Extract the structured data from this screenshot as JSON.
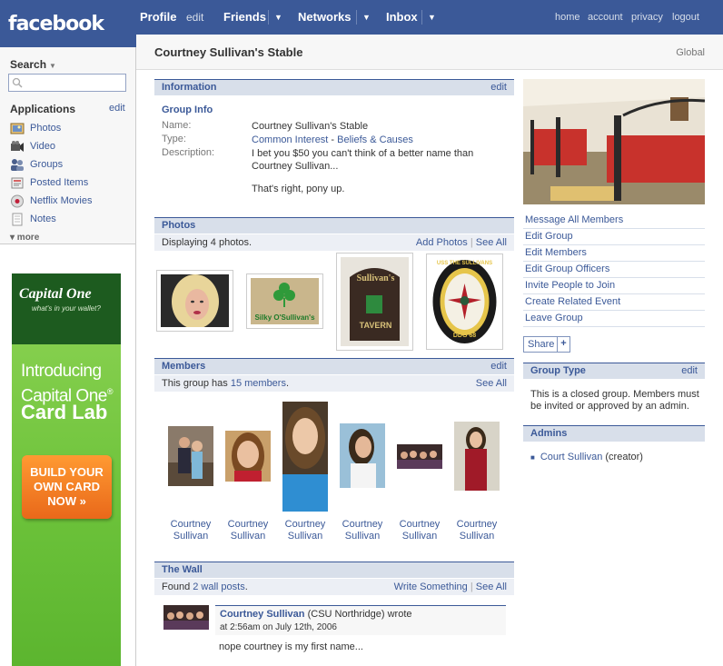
{
  "header": {
    "logo": "facebook",
    "nav": [
      {
        "label": "Profile",
        "sub": "edit"
      },
      {
        "label": "Friends",
        "arrow": "▼"
      },
      {
        "label": "Networks",
        "arrow": "▼"
      },
      {
        "label": "Inbox",
        "arrow": "▼"
      }
    ],
    "right_links": [
      "home",
      "account",
      "privacy",
      "logout"
    ]
  },
  "sidebar": {
    "search_label": "Search",
    "search_caret": "▼",
    "search_placeholder": "",
    "apps_title": "Applications",
    "apps_edit": "edit",
    "apps": [
      {
        "label": "Photos",
        "icon": "photos-icon"
      },
      {
        "label": "Video",
        "icon": "video-icon"
      },
      {
        "label": "Groups",
        "icon": "groups-icon"
      },
      {
        "label": "Posted Items",
        "icon": "posted-items-icon"
      },
      {
        "label": "Netflix Movies",
        "icon": "netflix-icon"
      },
      {
        "label": "Notes",
        "icon": "notes-icon"
      }
    ],
    "more": "▾ more"
  },
  "ad": {
    "brand": "Capital One",
    "tagline": "what's in your wallet?",
    "intro": "Introducing Capital One",
    "reg": "®",
    "product": "Card Lab",
    "cta": "BUILD YOUR OWN CARD NOW »"
  },
  "page": {
    "title": "Courtney Sullivan's Stable",
    "scope": "Global"
  },
  "information": {
    "title": "Information",
    "edit": "edit",
    "group_info": "Group Info",
    "name_label": "Name:",
    "name_value": "Courtney Sullivan's Stable",
    "type_label": "Type:",
    "type_value_1": "Common Interest",
    "type_sep": " - ",
    "type_value_2": "Beliefs & Causes",
    "desc_label": "Description:",
    "desc_line1": "I bet you $50 you can't think of a better name than Courtney Sullivan...",
    "desc_line2": "That's right, pony up."
  },
  "photos": {
    "title": "Photos",
    "count_text": "Displaying 4 photos.",
    "add": "Add Photos",
    "sep": "|",
    "see_all": "See All",
    "items": [
      {
        "caption": ""
      },
      {
        "caption": "Silky O'Sullivan's"
      },
      {
        "caption": "Sullivan's"
      },
      {
        "caption": "USS THE SULLIVANS"
      }
    ],
    "tavern_word": "TAVERN",
    "ship_number": "DDG 68"
  },
  "members": {
    "title": "Members",
    "edit": "edit",
    "count_prefix": "This group has ",
    "count_link": "15 members",
    "count_suffix": ".",
    "see_all": "See All",
    "list": [
      {
        "first": "Courtney",
        "last": "Sullivan"
      },
      {
        "first": "Courtney",
        "last": "Sullivan"
      },
      {
        "first": "Courtney",
        "last": "Sullivan"
      },
      {
        "first": "Courtney",
        "last": "Sullivan"
      },
      {
        "first": "Courtney",
        "last": "Sullivan"
      },
      {
        "first": "Courtney",
        "last": "Sullivan"
      }
    ]
  },
  "wall": {
    "title": "The Wall",
    "found_prefix": "Found ",
    "found_link": "2 wall posts",
    "found_suffix": ".",
    "write": "Write Something",
    "sep": "|",
    "see_all": "See All",
    "post": {
      "author": "Courtney Sullivan",
      "network": " (CSU Northridge) wrote",
      "time": "at 2:56am on July 12th, 2006",
      "body": "nope courtney is my first name..."
    }
  },
  "actions": [
    "Message All Members",
    "Edit Group",
    "Edit Members",
    "Edit Group Officers",
    "Invite People to Join",
    "Create Related Event",
    "Leave Group"
  ],
  "share": {
    "label": "Share",
    "plus": "+"
  },
  "group_type": {
    "title": "Group Type",
    "edit": "edit",
    "text": "This is a closed group. Members must be invited or approved by an admin."
  },
  "admins": {
    "title": "Admins",
    "bullet": "■",
    "name": "Court Sullivan",
    "role": " (creator)"
  },
  "colors": {
    "brand_blue": "#3b5998",
    "bar_light": "#d8dfea",
    "ad_green": "#6cc23a",
    "ad_orange": "#f0781f"
  }
}
